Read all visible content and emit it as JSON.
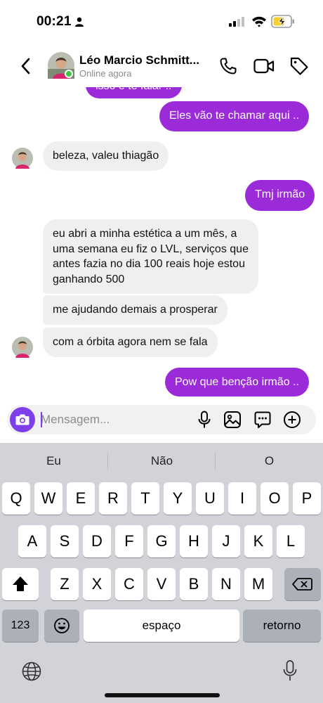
{
  "status_bar": {
    "time": "00:21"
  },
  "header": {
    "contact_name": "Léo Marcio Schmitt...",
    "contact_status": "Online agora"
  },
  "messages": [
    {
      "direction": "out",
      "text": "isso é te falar !!"
    },
    {
      "direction": "out",
      "text": "Eles vão te chamar aqui .."
    },
    {
      "direction": "in",
      "text": "beleza, valeu thiagão"
    },
    {
      "direction": "out",
      "text": "Tmj irmão"
    },
    {
      "direction": "in",
      "lines": [
        "eu abri a minha estética a um mês, a",
        "uma semana eu fiz o LVL, serviços que",
        "antes fazia no dia 100 reais hoje estou",
        "ganhando 500"
      ]
    },
    {
      "direction": "in",
      "text": "me ajudando demais a prosperar"
    },
    {
      "direction": "in",
      "text": "com a órbita agora nem se fala"
    },
    {
      "direction": "out",
      "text": "Pow que benção irmão .."
    }
  ],
  "composer": {
    "placeholder": "Mensagem..."
  },
  "keyboard": {
    "suggestions": [
      "Eu",
      "Não",
      "O"
    ],
    "row1": [
      "Q",
      "W",
      "E",
      "R",
      "T",
      "Y",
      "U",
      "I",
      "O",
      "P"
    ],
    "row2": [
      "A",
      "S",
      "D",
      "F",
      "G",
      "H",
      "J",
      "K",
      "L"
    ],
    "row3": [
      "Z",
      "X",
      "C",
      "V",
      "B",
      "N",
      "M"
    ],
    "numbers_key": "123",
    "space_key": "espaço",
    "return_key": "retorno"
  },
  "colors": {
    "outgoing_bubble": "#9b2ad9",
    "incoming_bubble": "#efeff1",
    "camera_button": "#7e3fe8",
    "online_indicator": "#3dc83d",
    "battery_fill": "#f5cf34"
  },
  "icons": {
    "status": [
      "person-icon",
      "signal-icon",
      "wifi-icon",
      "battery-charging-icon"
    ],
    "header": [
      "back-icon",
      "phone-icon",
      "video-camera-icon",
      "tag-icon"
    ],
    "composer": [
      "camera-icon",
      "microphone-icon",
      "image-icon",
      "sticker-icon",
      "plus-circle-icon"
    ],
    "keyboard": [
      "shift-icon",
      "backspace-icon",
      "emoji-icon",
      "globe-icon",
      "dictation-icon"
    ]
  }
}
